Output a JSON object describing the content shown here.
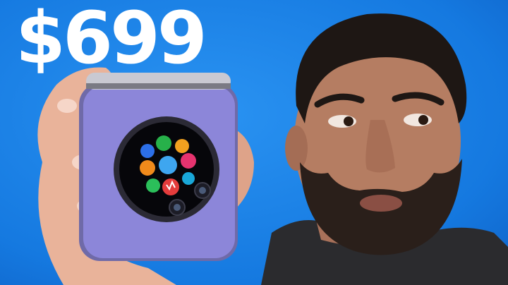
{
  "thumbnail": {
    "price_text": "$699",
    "background_color": "#1e86ea",
    "phone_color": "#8c86d9",
    "icons": [
      "moon-icon",
      "workout-icon",
      "phone-icon",
      "clock-icon",
      "weather-icon",
      "music-icon",
      "messages-icon",
      "heart-rate-icon",
      "activity-icon"
    ]
  }
}
